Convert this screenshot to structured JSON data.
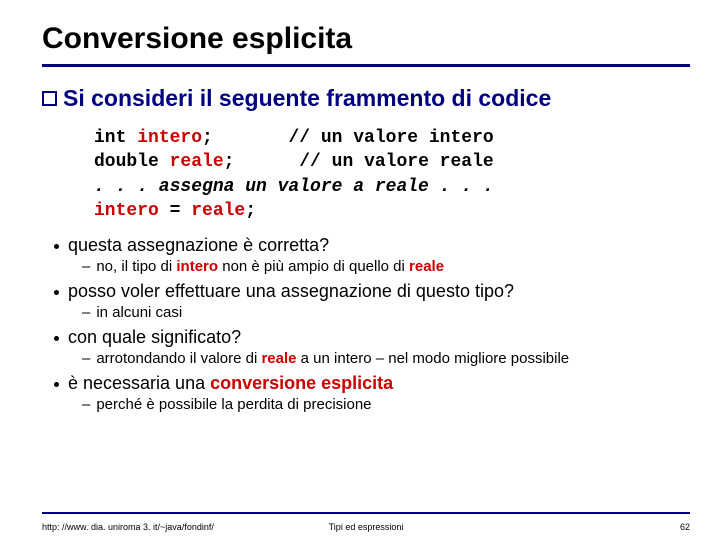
{
  "title": "Conversione esplicita",
  "main_bullet": "Si consideri il seguente frammento di codice",
  "code": {
    "l1a": "int ",
    "l1b": "intero",
    "l1c": ";       // un valore intero",
    "l2a": "double ",
    "l2b": "reale",
    "l2c": ";      // un valore reale",
    "l3": ". . . assegna un valore a reale . . .",
    "l4a": "intero",
    "l4b": " = ",
    "l4c": "reale",
    "l4d": ";"
  },
  "qa": [
    {
      "q": "questa assegnazione è corretta?",
      "a_parts": [
        "no, il tipo di ",
        "intero",
        " non è più ampio di quello di ",
        "reale"
      ]
    },
    {
      "q": "posso voler effettuare una assegnazione di questo tipo?",
      "a_parts": [
        "in alcuni casi"
      ]
    },
    {
      "q": "con quale significato?",
      "a_parts": [
        "arrotondando il valore di ",
        "reale",
        " a un intero – nel modo migliore possibile"
      ]
    },
    {
      "q_parts": [
        "è necessaria una ",
        "conversione esplicita"
      ],
      "a_parts": [
        "perché è possibile la perdita di precisione"
      ]
    }
  ],
  "footer": {
    "left": "http: //www. dia. uniroma 3. it/~java/fondinf/",
    "center": "Tipi ed espressioni",
    "right": "62"
  }
}
